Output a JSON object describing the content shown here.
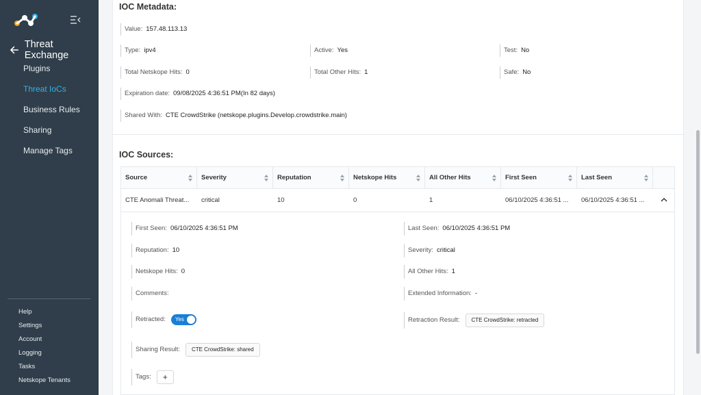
{
  "sidebar": {
    "section_title": "Threat Exchange",
    "nav": [
      "Plugins",
      "Threat IoCs",
      "Business Rules",
      "Sharing",
      "Manage Tags"
    ],
    "active_index": 1,
    "bottom_nav": [
      "Help",
      "Settings",
      "Account",
      "Logging",
      "Tasks",
      "Netskope Tenants"
    ],
    "accent_color": "#36b1e6"
  },
  "metadata": {
    "title": "IOC Metadata:",
    "value_label": "Value:",
    "value": "157.48.113.13",
    "type_label": "Type:",
    "type": "ipv4",
    "active_label": "Active:",
    "active": "Yes",
    "test_label": "Test:",
    "test": "No",
    "netskope_hits_label": "Total Netskope Hits:",
    "netskope_hits": "0",
    "other_hits_label": "Total Other Hits:",
    "other_hits": "1",
    "safe_label": "Safe:",
    "safe": "No",
    "expiration_label": "Expiration date:",
    "expiration": "09/08/2025 4:36:51 PM(In 82 days)",
    "shared_label": "Shared With:",
    "shared": "CTE CrowdStrike (netskope.plugins.Develop.crowdstrike.main)"
  },
  "sources": {
    "title": "IOC Sources:",
    "columns": [
      "Source",
      "Severity",
      "Reputation",
      "Netskope Hits",
      "All Other Hits",
      "First Seen",
      "Last Seen"
    ],
    "row": [
      "CTE Anomali Threat...",
      "critical",
      "10",
      "0",
      "1",
      "06/10/2025 4:36:51 ...",
      "06/10/2025 4:36:51 ..."
    ],
    "detail": {
      "first_seen_label": "First Seen:",
      "first_seen": "06/10/2025 4:36:51 PM",
      "last_seen_label": "Last Seen:",
      "last_seen": "06/10/2025 4:36:51 PM",
      "reputation_label": "Reputation:",
      "reputation": "10",
      "severity_label": "Severity:",
      "severity": "critical",
      "netskope_hits_label": "Netskope Hits:",
      "netskope_hits": "0",
      "other_hits_label": "All Other Hits:",
      "other_hits": "1",
      "comments_label": "Comments:",
      "extended_label": "Extended Information:",
      "extended": "-",
      "retracted_label": "Retracted:",
      "retracted_toggle": "Yes",
      "retraction_result_label": "Retraction Result:",
      "retraction_result": "CTE CrowdStrike: retracted",
      "sharing_result_label": "Sharing Result:",
      "sharing_result": "CTE CrowdStrike: shared",
      "tags_label": "Tags:",
      "tags_add": "+"
    }
  }
}
